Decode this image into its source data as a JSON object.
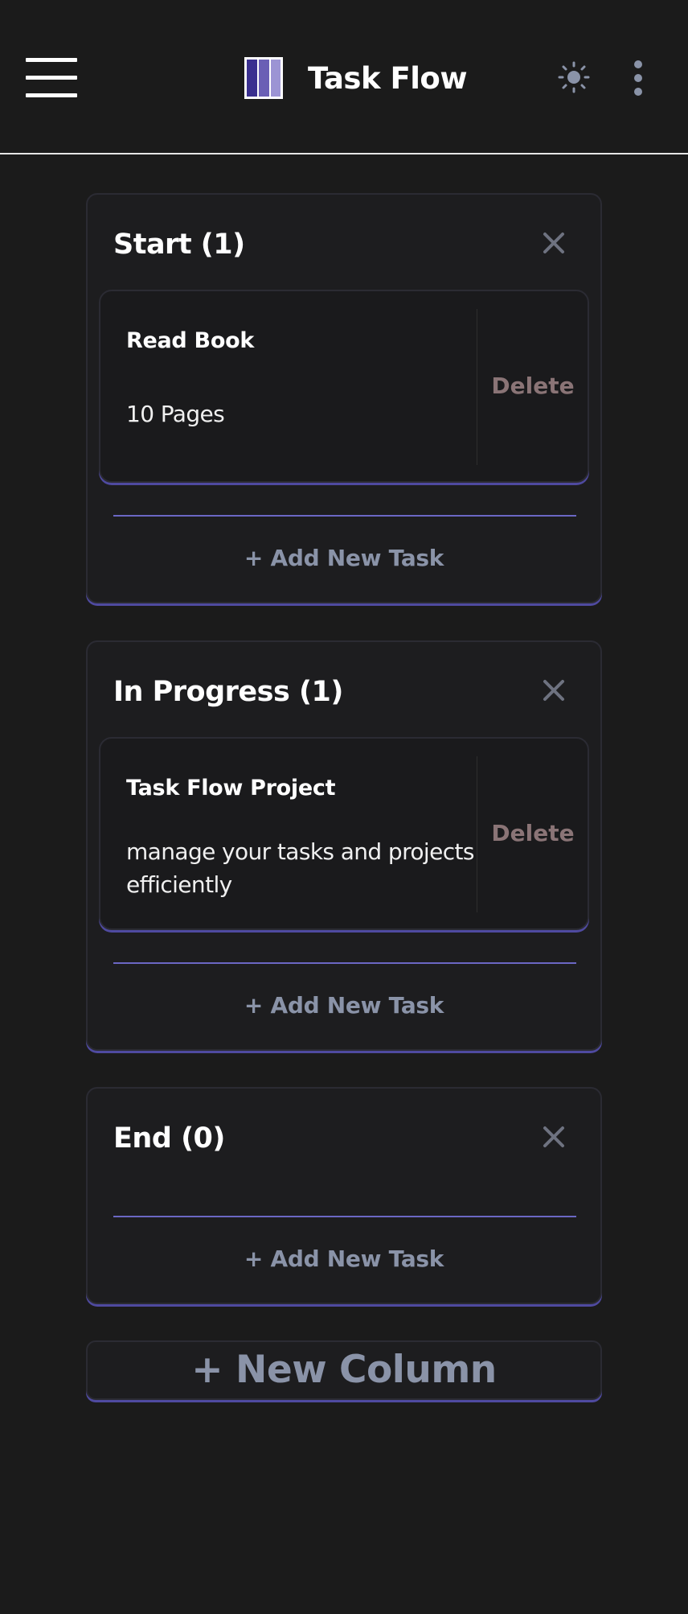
{
  "header": {
    "title": "Task Flow",
    "menu_icon": "hamburger-menu-icon",
    "logo_icon": "kanban-columns-icon",
    "theme_icon": "sun-icon",
    "more_icon": "kebab-vertical-icon"
  },
  "columns": [
    {
      "title": "Start (1)",
      "tasks": [
        {
          "title": "Read Book",
          "description": "10 Pages",
          "delete_label": "Delete"
        }
      ],
      "add_task_label": "+ Add New Task"
    },
    {
      "title": "In Progress (1)",
      "tasks": [
        {
          "title": "Task Flow Project",
          "description": "manage your tasks and projects efficiently",
          "delete_label": "Delete"
        }
      ],
      "add_task_label": "+ Add New Task"
    },
    {
      "title": "End (0)",
      "tasks": [],
      "add_task_label": "+ Add New Task"
    }
  ],
  "new_column_label": "+ New Column",
  "colors": {
    "background": "#1b1b1b",
    "accent": "#6b67c4",
    "delete_text": "#8a7476",
    "muted_text": "#8a93a8"
  }
}
